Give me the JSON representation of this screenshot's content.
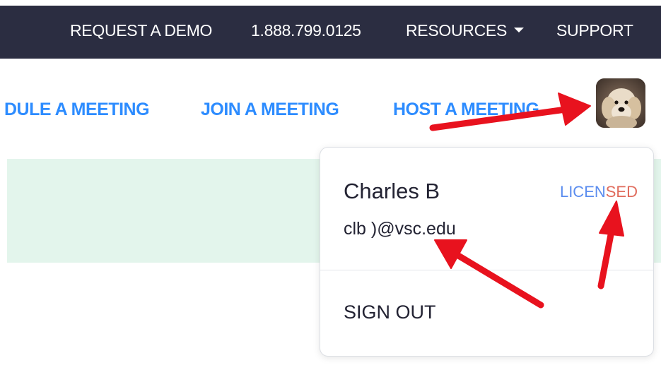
{
  "topbar": {
    "request_demo": "REQUEST A DEMO",
    "phone": "1.888.799.0125",
    "resources": "RESOURCES",
    "support": "SUPPORT"
  },
  "nav": {
    "schedule": "DULE A MEETING",
    "join": "JOIN A MEETING",
    "host": "HOST A MEETING"
  },
  "account": {
    "name": "Charles B",
    "email": "clb           )@vsc.edu",
    "license": "LICENSED",
    "sign_out": "SIGN OUT"
  },
  "colors": {
    "topbar_bg": "#2b2d41",
    "link_blue": "#2d8cff",
    "banner_green": "#e3f5ec",
    "arrow_red": "#e8121e"
  },
  "icons": {
    "caret": "chevron-down-icon",
    "avatar": "user-avatar-photo"
  }
}
